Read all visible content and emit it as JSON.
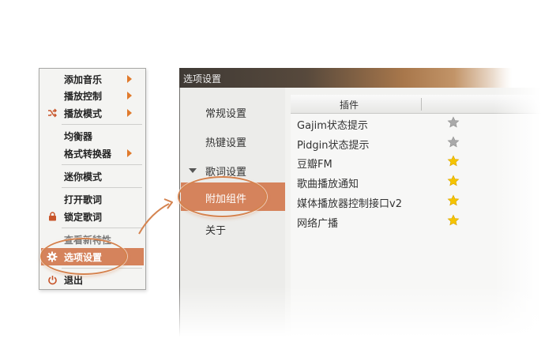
{
  "context_menu": {
    "items": [
      {
        "label": "添加音乐",
        "has_submenu": true
      },
      {
        "label": "播放控制",
        "has_submenu": true
      },
      {
        "label": "播放模式",
        "has_submenu": true,
        "icon": "shuffle-icon"
      },
      {
        "label": "均衡器",
        "has_submenu": false
      },
      {
        "label": "格式转换器",
        "has_submenu": true
      },
      {
        "label": "迷你模式",
        "has_submenu": false
      },
      {
        "label": "打开歌词",
        "has_submenu": false
      },
      {
        "label": "锁定歌词",
        "has_submenu": false,
        "icon": "lock-icon"
      },
      {
        "label": "查看新特性",
        "has_submenu": false
      },
      {
        "label": "选项设置",
        "has_submenu": false,
        "icon": "gear-icon",
        "selected": true
      },
      {
        "label": "退出",
        "has_submenu": false,
        "icon": "power-icon"
      }
    ]
  },
  "window": {
    "title": "选项设置",
    "sidebar": {
      "items": [
        {
          "label": "常规设置"
        },
        {
          "label": "热键设置"
        },
        {
          "label": "歌词设置",
          "expandable": true
        },
        {
          "label": "附加组件",
          "selected": true
        },
        {
          "label": "关于"
        }
      ]
    },
    "plugins": {
      "column_header": "插件",
      "rows": [
        {
          "name": "Gajim状态提示",
          "enabled": false
        },
        {
          "name": "Pidgin状态提示",
          "enabled": false
        },
        {
          "name": "豆瓣FM",
          "enabled": true
        },
        {
          "name": "歌曲播放通知",
          "enabled": true
        },
        {
          "name": "媒体播放器控制接口v2",
          "enabled": true
        },
        {
          "name": "网络广播",
          "enabled": true
        }
      ]
    }
  },
  "colors": {
    "accent": "#d5835c",
    "submenu_arrow": "#e07a2c",
    "star_on": "#f5c400",
    "star_off": "#a9a9a9",
    "highlight_oval": "#d5834f"
  }
}
